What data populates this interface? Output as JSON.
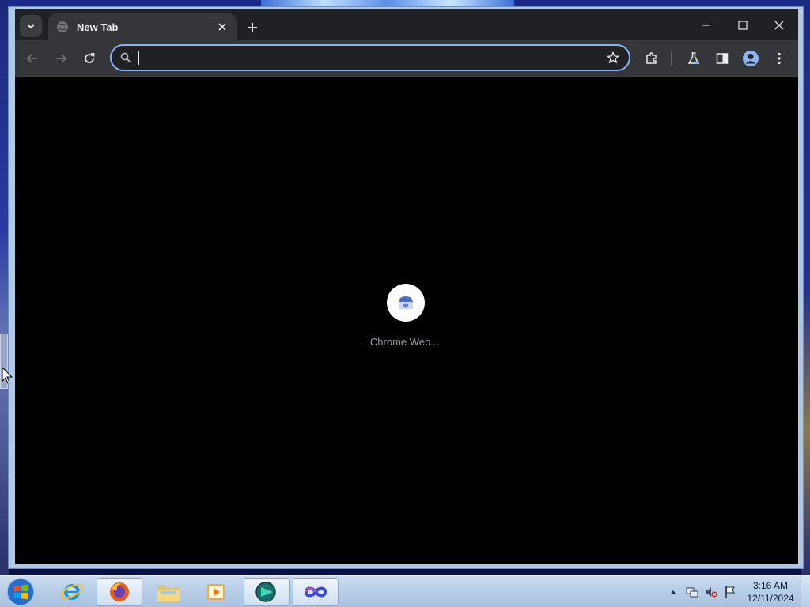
{
  "browser": {
    "tab": {
      "title": "New Tab"
    },
    "omnibox": {
      "value": "",
      "placeholder": ""
    },
    "loading_label": "Chrome Web...",
    "accent_color": "#8ab4f8"
  },
  "taskbar": {
    "clock_time": "3:16 AM",
    "clock_date": "12/11/2024",
    "apps": [
      {
        "name": "internet-explorer"
      },
      {
        "name": "firefox"
      },
      {
        "name": "file-explorer"
      },
      {
        "name": "media-player"
      },
      {
        "name": "chrome-app"
      },
      {
        "name": "infinity-app"
      }
    ]
  }
}
